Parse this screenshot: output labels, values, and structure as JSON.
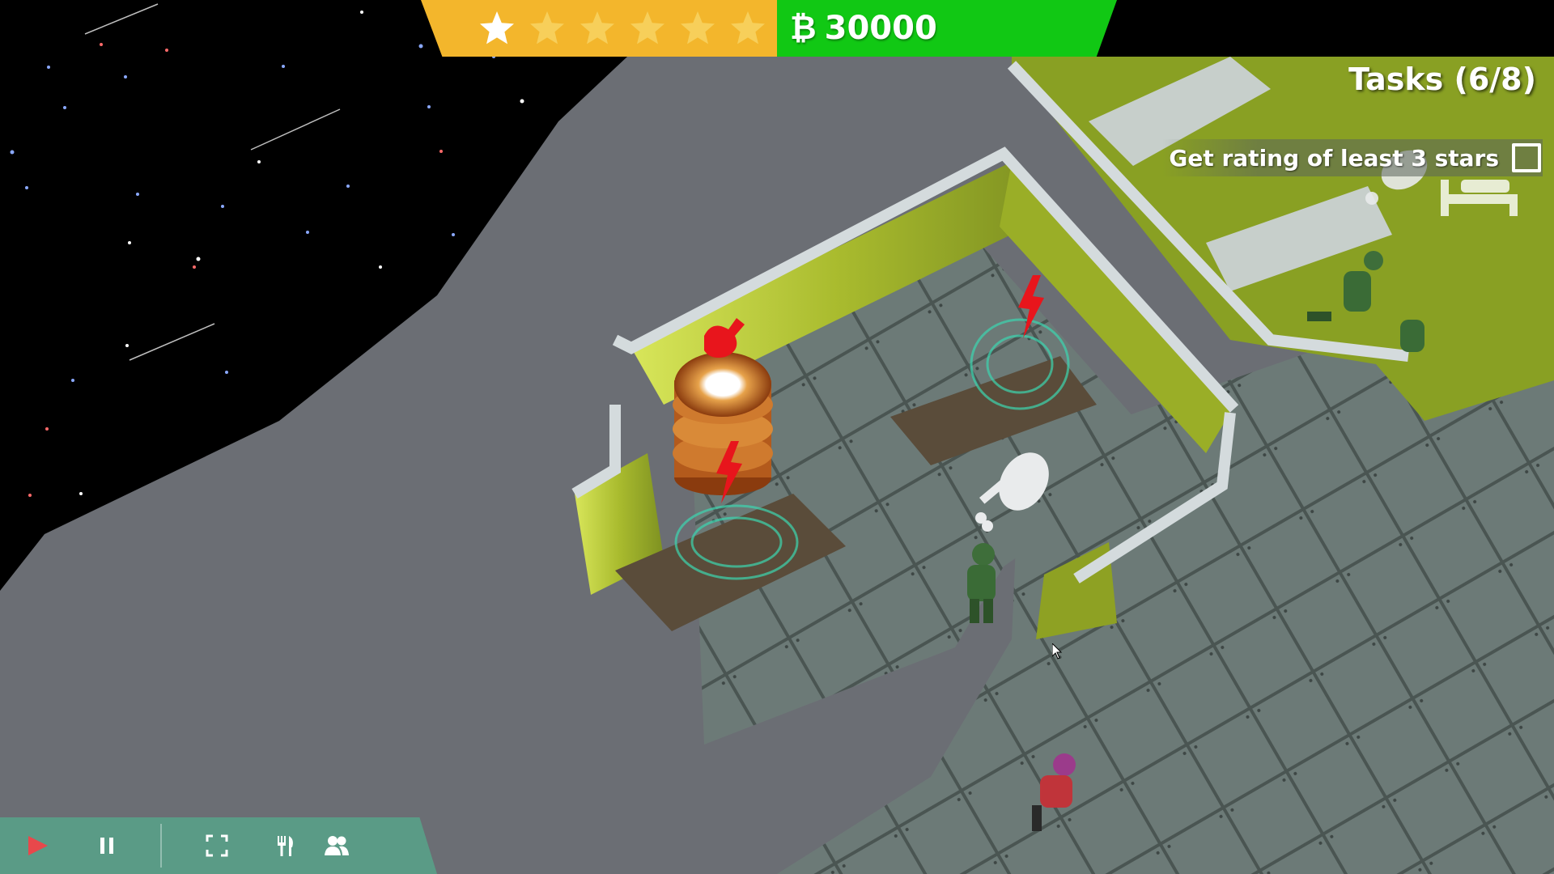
{
  "hud": {
    "rating": {
      "filled_stars": 1,
      "total_stars": 6,
      "filled_color": "#ffffff",
      "empty_color": "#f7cf5a",
      "icon": "star-icon"
    },
    "money": {
      "currency_symbol": "₿",
      "value": "30000"
    }
  },
  "tasks": {
    "title": "Tasks (6/8)",
    "items": [
      {
        "label": "Get rating of least 3 stars",
        "checked": false
      }
    ]
  },
  "toolbar": {
    "buttons": [
      {
        "name": "play-button",
        "icon": "play-icon",
        "color": "#e8484b"
      },
      {
        "name": "pause-button",
        "icon": "pause-icon",
        "color": "#ffffff"
      },
      {
        "name": "fullscreen-button",
        "icon": "fullscreen-icon",
        "color": "#ffffff"
      },
      {
        "name": "food-button",
        "icon": "fork-knife-icon",
        "color": "#ffffff"
      },
      {
        "name": "crew-button",
        "icon": "people-icon",
        "color": "#ffffff"
      }
    ]
  },
  "colors": {
    "space": "#000000",
    "hull": "#6b6e74",
    "floor": "#6a7a76",
    "wall": "#b3c436",
    "rating_panel": "#f3b62c",
    "money_panel": "#11c814",
    "toolbar": "#5a9b86",
    "alert": "#e8151c"
  }
}
